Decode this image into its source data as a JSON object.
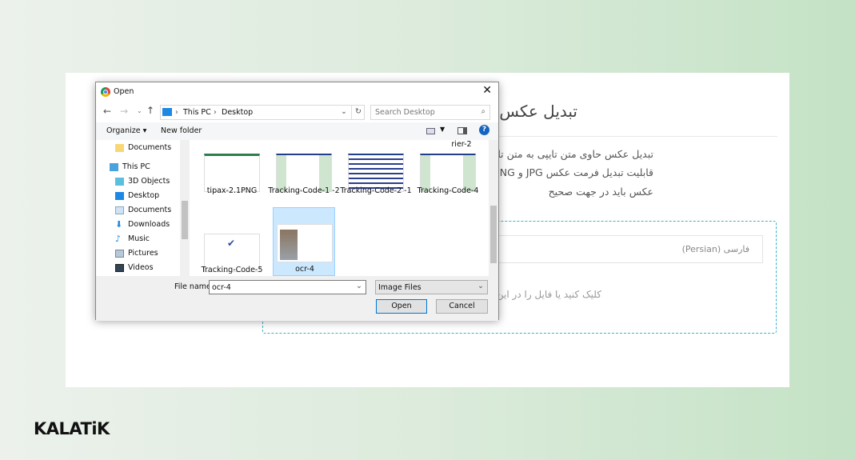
{
  "page": {
    "title": "تبدیل عکس ب",
    "bullets": [
      "تبدیل عکس حاوی متن تایپی به متن تای",
      "قابلیت تبدیل فرمت عکس JPG و NG",
      "عکس باید در جهت صحیح"
    ],
    "language_select": "فارسی (Persian)",
    "drop_hint": "کلیک کنید یا فایل را در این",
    "accent_color": "#3bb0c9"
  },
  "logo": "KALATiK",
  "dialog": {
    "title": "Open",
    "breadcrumb": [
      "This PC",
      "Desktop"
    ],
    "search_placeholder": "Search Desktop",
    "organize": "Organize ▾",
    "new_folder": "New folder",
    "nav_items": [
      "Documents",
      "This PC",
      "3D Objects",
      "Desktop",
      "Documents",
      "Downloads",
      "Music",
      "Pictures",
      "Videos"
    ],
    "partial_top_label": "rier-2",
    "files": [
      {
        "name": "tipax-2.1PNG"
      },
      {
        "name": "Tracking-Code-1 -2"
      },
      {
        "name": "Tracking-Code-2 -1"
      },
      {
        "name": "Tracking-Code-4"
      },
      {
        "name": "Tracking-Code-5"
      },
      {
        "name": "ocr-4",
        "selected": true
      }
    ],
    "file_name_label": "File name:",
    "file_name_value": "ocr-4",
    "file_type": "Image Files",
    "open": "Open",
    "cancel": "Cancel"
  }
}
